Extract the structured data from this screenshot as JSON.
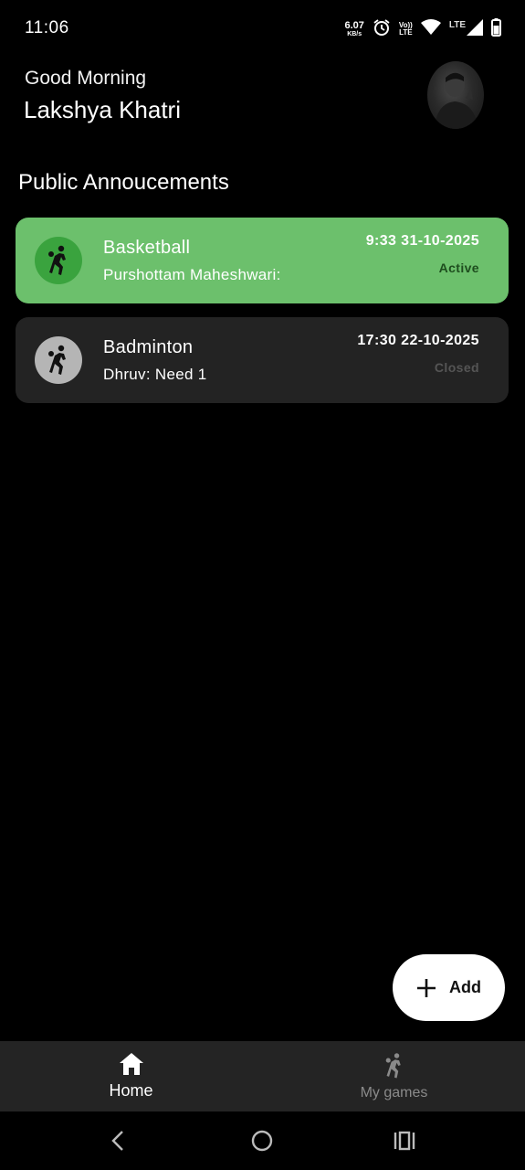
{
  "status_bar": {
    "time": "11:06",
    "net_speed_value": "6.07",
    "net_speed_unit": "KB/s",
    "volte_top": "Vo))",
    "volte_bottom": "LTE",
    "lte_label": "LTE",
    "icons": [
      "alarm-icon",
      "wifi-icon",
      "signal-icon",
      "battery-icon"
    ]
  },
  "header": {
    "greeting": "Good Morning",
    "user_name": "Lakshya Khatri",
    "avatar_icon": "profile-photo"
  },
  "section": {
    "title": "Public Annoucements"
  },
  "announcements": [
    {
      "sport": "Basketball",
      "message": "Purshottam Maheshwari:",
      "datetime": "9:33 31-10-2025",
      "status": "Active",
      "icon": "player-icon",
      "card_color": "#6cc06c",
      "icon_bg_color": "#3aa33e",
      "status_color": "#1e4d1e"
    },
    {
      "sport": "Badminton",
      "message": "Dhruv: Need 1",
      "datetime": "17:30 22-10-2025",
      "status": "Closed",
      "icon": "player-icon",
      "card_color": "#232323",
      "icon_bg_color": "#b5b5b5",
      "status_color": "#555555"
    }
  ],
  "fab": {
    "label": "Add",
    "icon": "plus-icon"
  },
  "bottom_nav": {
    "items": [
      {
        "label": "Home",
        "icon": "home-icon",
        "active": true
      },
      {
        "label": "My games",
        "icon": "player-icon",
        "active": false
      }
    ]
  },
  "system_nav": {
    "icons": [
      "back-icon",
      "home-circle-icon",
      "recents-icon"
    ]
  },
  "colors": {
    "background": "#000000",
    "active_green": "#6cc06c",
    "nav_background": "#242424"
  }
}
